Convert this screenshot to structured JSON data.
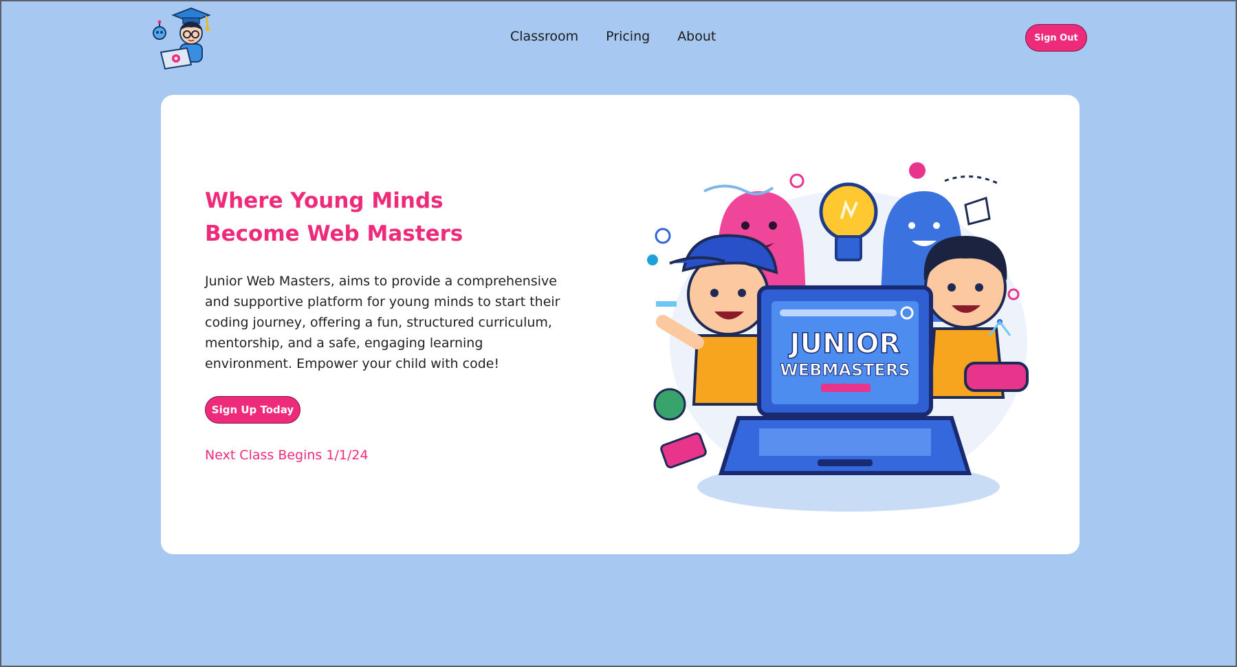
{
  "nav": {
    "links": [
      "Classroom",
      "Pricing",
      "About"
    ],
    "sign_out": "Sign Out"
  },
  "hero": {
    "title_line1": "Where Young Minds",
    "title_line2": "Become Web Masters",
    "description": "Junior Web Masters, aims to provide a comprehensive and supportive platform for young minds to start their coding journey, offering a fun, structured curriculum, mentorship, and a safe, engaging learning environment. Empower your child with code!",
    "cta": "Sign Up Today",
    "next_class": "Next Class Begins 1/1/24"
  },
  "illustration": {
    "laptop_line1": "JUNIOR",
    "laptop_line2": "WEBMASTERS"
  },
  "colors": {
    "accent": "#ee2a7b",
    "page_bg": "#a7c8f0",
    "card_bg": "#ffffff"
  }
}
